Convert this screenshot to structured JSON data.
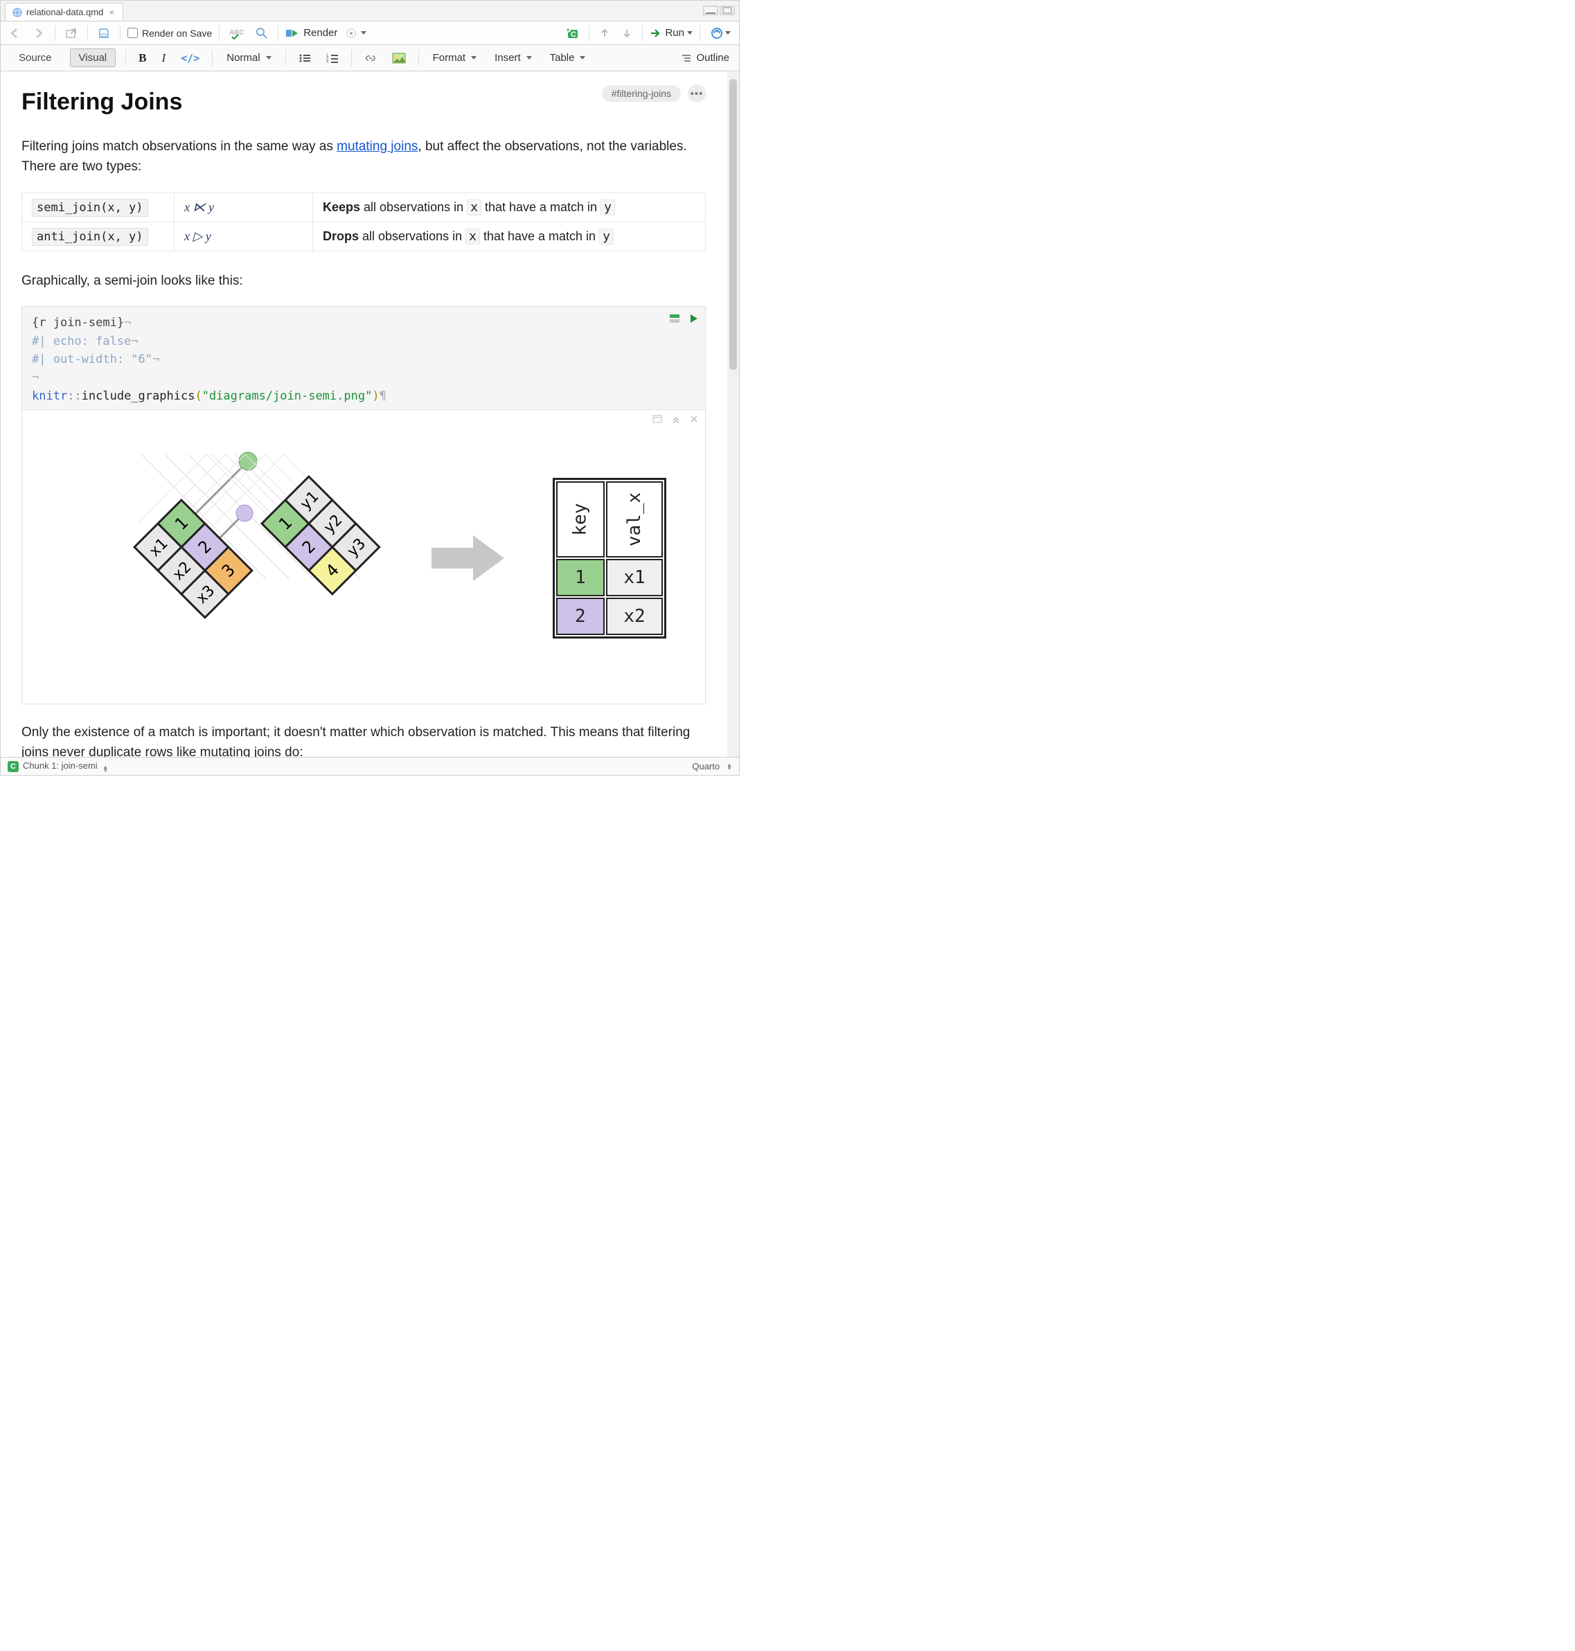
{
  "tab": {
    "filename": "relational-data.qmd"
  },
  "file_toolbar": {
    "render_on_save_label": "Render on Save",
    "render_label": "Render",
    "run_label": "Run"
  },
  "editor_toolbar": {
    "source_label": "Source",
    "visual_label": "Visual",
    "paragraph_style": "Normal",
    "menu_format": "Format",
    "menu_insert": "Insert",
    "menu_table": "Table",
    "outline_label": "Outline"
  },
  "section": {
    "heading": "Filtering Joins",
    "tag": "#filtering-joins",
    "intro_prefix": "Filtering joins match observations in the same way as ",
    "intro_link": "mutating joins",
    "intro_suffix": ", but affect the observations, not the variables. There are two types:"
  },
  "join_table": {
    "rows": [
      {
        "func": "semi_join(x, y)",
        "math": "x ⋉ y",
        "desc_strong": "Keeps",
        "desc_mid": " all observations in ",
        "var1": "x",
        "desc_mid2": " that have a match in ",
        "var2": "y"
      },
      {
        "func": "anti_join(x, y)",
        "math": "x ▷ y",
        "desc_strong": "Drops",
        "desc_mid": " all observations in ",
        "var1": "x",
        "desc_mid2": " that have a match in ",
        "var2": "y"
      }
    ]
  },
  "section2_text": "Graphically, a semi-join looks like this:",
  "chunk": {
    "header": "{r join-semi}",
    "opt1": "#| echo: false",
    "opt2": "#| out-width: \"6\"",
    "ns": "knitr",
    "dbl": "::",
    "fn": "include_graphics",
    "arg": "\"diagrams/join-semi.png\""
  },
  "diagram": {
    "left_keys": [
      "1",
      "2",
      "3"
    ],
    "left_vals": [
      "x1",
      "x2",
      "x3"
    ],
    "right_keys": [
      "1",
      "2",
      "4"
    ],
    "right_vals": [
      "y1",
      "y2",
      "y3"
    ],
    "result": {
      "headers": [
        "key",
        "val_x"
      ],
      "rows": [
        {
          "key": "1",
          "val": "x1",
          "color": "#9ad08f"
        },
        {
          "key": "2",
          "val": "x2",
          "color": "#cfc2e8"
        }
      ]
    }
  },
  "section3_text": "Only the existence of a match is important; it doesn't matter which observation is matched. This means that filtering joins never duplicate rows like mutating joins do:",
  "statusbar": {
    "chunk_label": "Chunk 1: join-semi",
    "engine": "Quarto"
  },
  "colors": {
    "green": "#9ad08f",
    "purple": "#cfc2e8",
    "orange": "#f3b96b",
    "yellow": "#f6f29c",
    "grey": "#e8e8e8"
  }
}
